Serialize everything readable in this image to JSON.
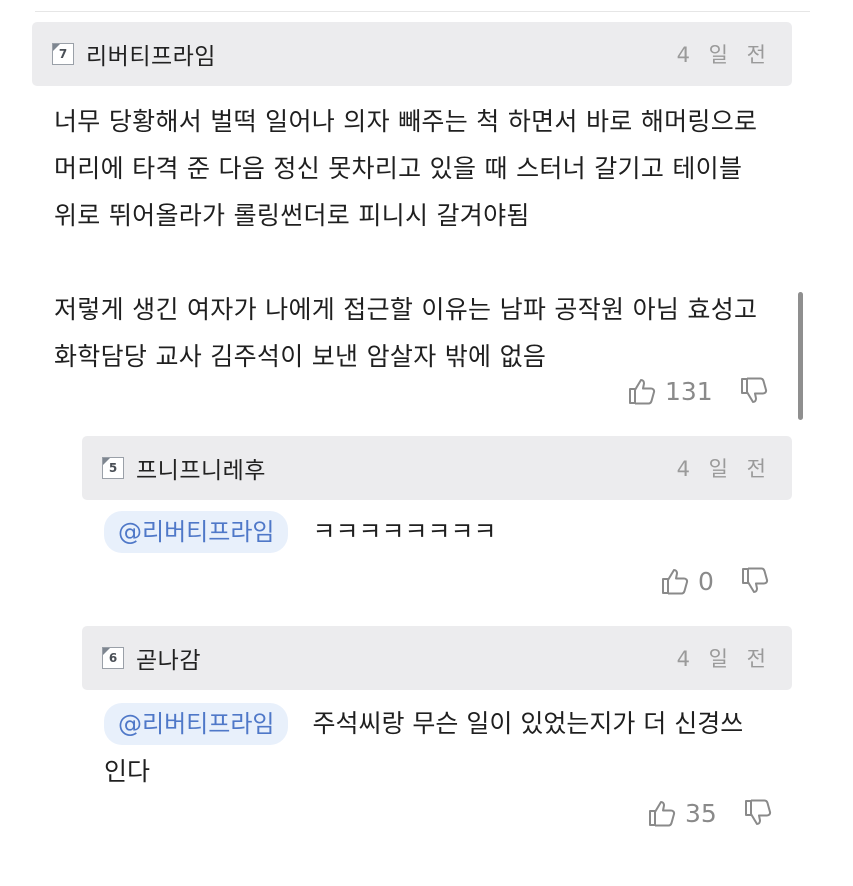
{
  "comment": {
    "level": "7",
    "nickname": "리버티프라임",
    "time": "4 일 전",
    "lines": [
      "너무 당황해서 벌떡 일어나 의자 빼주는 척 하면서 바로 해머링으로",
      "머리에 타격 준 다음 정신 못차리고 있을 때 스터너 갈기고 테이블",
      "위로 뛰어올라가 롤링썬더로 피니시 갈겨야됨",
      "저렇게 생긴 여자가 나에게 접근할 이유는 남파 공작원 아님 효성고",
      "화학담당 교사 김주석이 보낸 암살자 밖에 없음"
    ],
    "likes": "131"
  },
  "replies": [
    {
      "level": "5",
      "nickname": "프니프니레후",
      "time": "4 일 전",
      "mention": "@리버티프라임",
      "text": "ㅋㅋㅋㅋㅋㅋㅋㅋ",
      "likes": "0"
    },
    {
      "level": "6",
      "nickname": "곧나감",
      "time": "4 일 전",
      "mention": "@리버티프라임",
      "text": "주석씨랑 무슨 일이 있었는지가 더 신경쓰",
      "text_cont": "인다",
      "likes": "35"
    }
  ],
  "icons": {
    "like": "thumbs-up-icon",
    "dislike": "thumbs-down-icon"
  },
  "colors": {
    "header_bg": "#ececee",
    "mention_bg": "#e8f0fb",
    "mention_text": "#4f78c8",
    "muted": "#8a8a8a"
  }
}
